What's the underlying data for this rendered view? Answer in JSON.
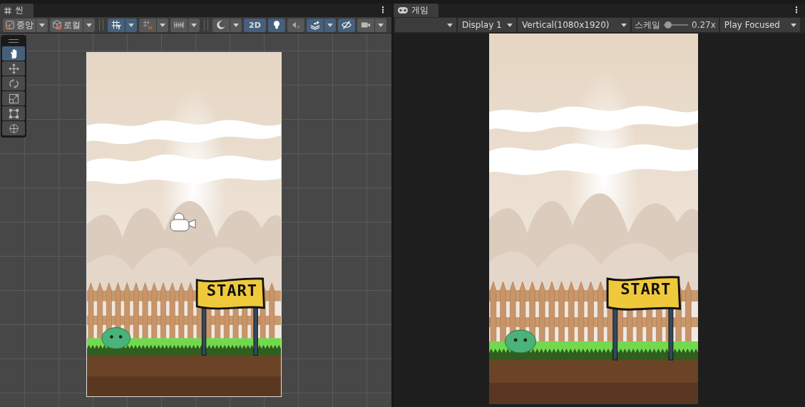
{
  "scene_panel": {
    "tab": {
      "label": "씬"
    },
    "menu_glyph": "⋮",
    "toolbar": [
      {
        "label": "중앙",
        "selected": false,
        "dropdown": true
      },
      {
        "label": "로컬",
        "selected": false,
        "dropdown": true
      },
      {
        "selected": true,
        "dropdown": true
      },
      {
        "selected": false,
        "dropdown": true
      },
      {
        "selected": false,
        "dropdown": true
      },
      {
        "selected": false,
        "dropdown": true
      },
      {
        "label": "2D",
        "selected": true,
        "dropdown": false
      },
      {
        "selected": true,
        "dropdown": false
      },
      {
        "selected": false,
        "dropdown": false
      },
      {
        "selected": true,
        "dropdown": true
      },
      {
        "selected": true,
        "dropdown": false
      },
      {
        "selected": false,
        "dropdown": true
      }
    ],
    "tools": [
      {
        "selected": true
      },
      {
        "selected": false
      },
      {
        "selected": false
      },
      {
        "selected": false
      },
      {
        "selected": false
      },
      {
        "selected": false
      }
    ],
    "sign_text": "START"
  },
  "game_panel": {
    "tab": {
      "label": "게임"
    },
    "menu_glyph": "⋮",
    "display": "Display 1",
    "resolution": "Vertical(1080x1920)",
    "scale": {
      "label": "스케일",
      "level": 0.04,
      "reading": "0.27x"
    },
    "play_mode": "Play Focused",
    "sign_text": "START"
  }
}
